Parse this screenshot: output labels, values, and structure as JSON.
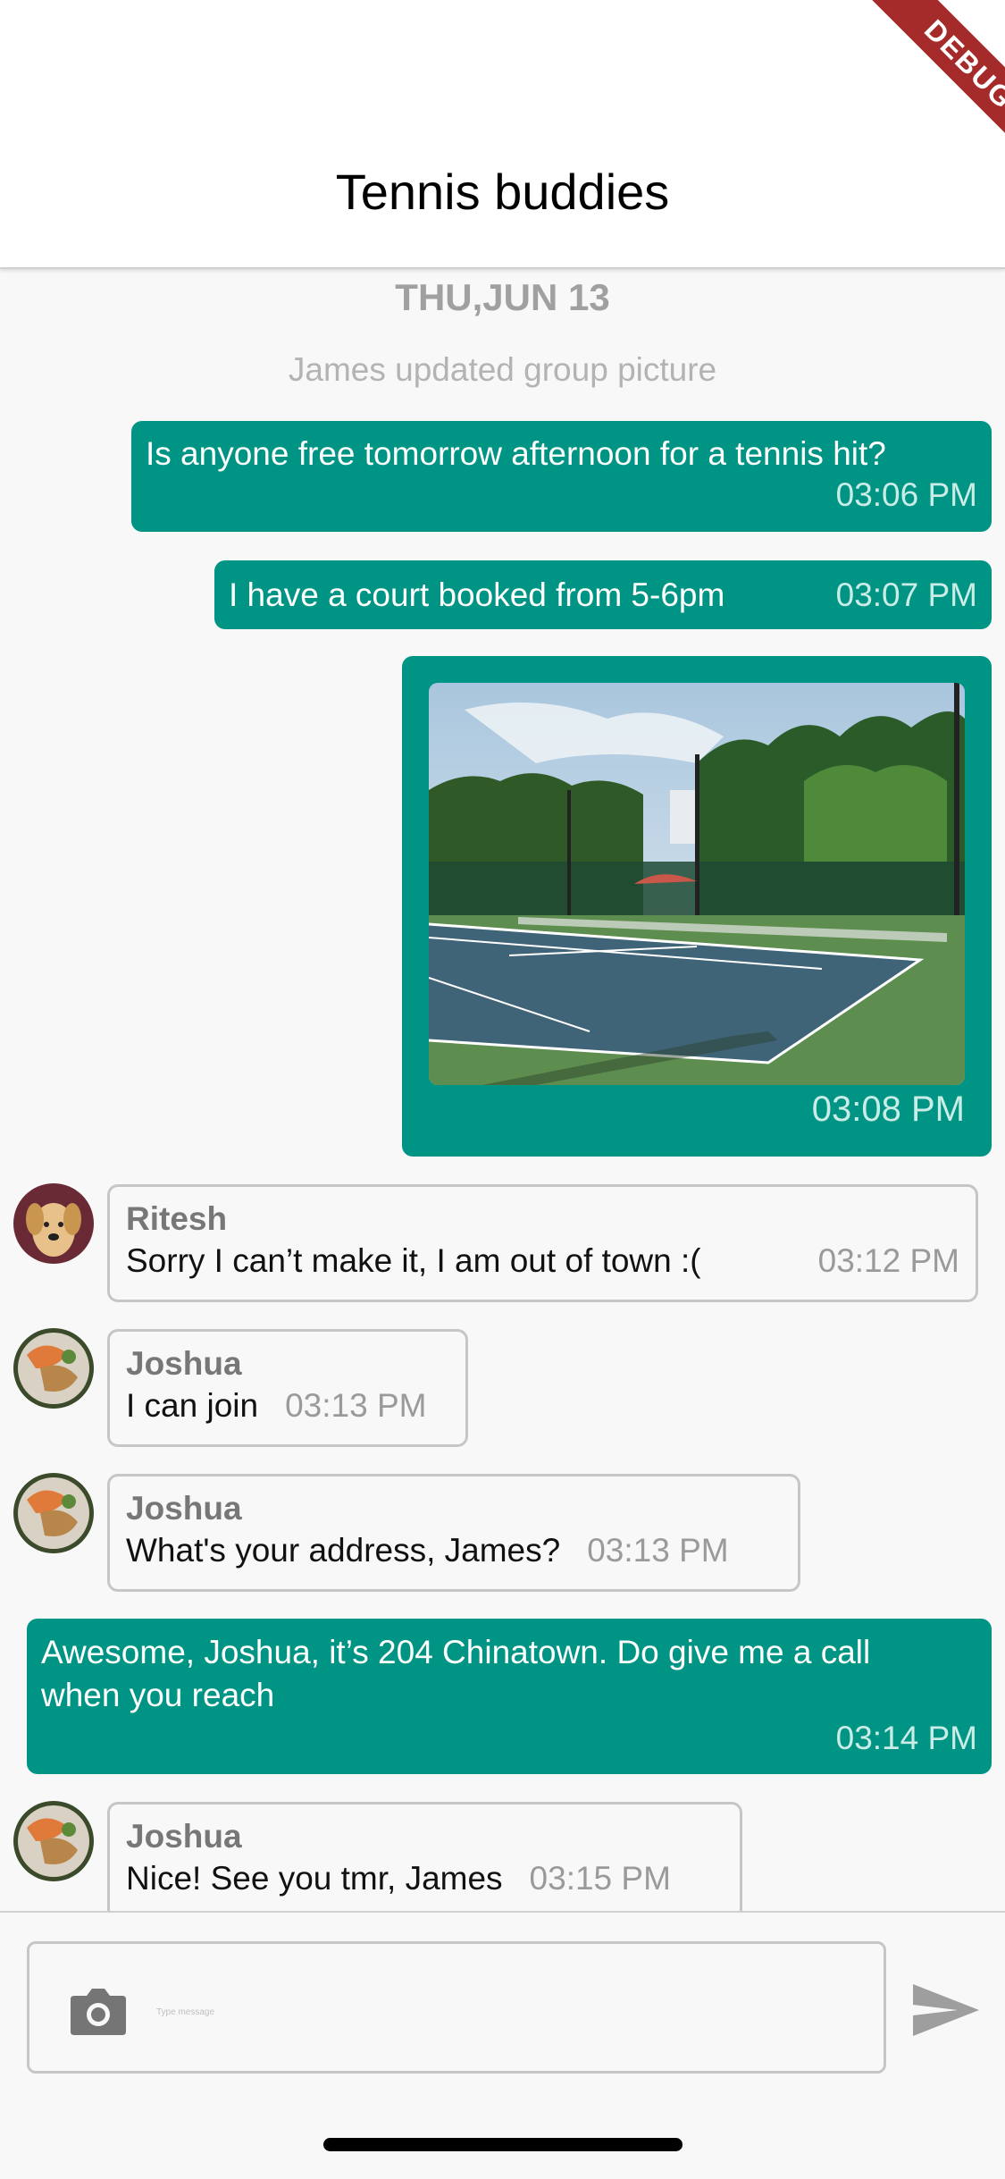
{
  "header": {
    "title": "Tennis buddies",
    "debug_label": "DEBUG"
  },
  "chat": {
    "date_label": "THU,JUN 13",
    "system_note": "James updated group picture",
    "messages": [
      {
        "direction": "out",
        "text": "Is anyone free tomorrow afternoon for a tennis hit?",
        "time": "03:06 PM"
      },
      {
        "direction": "out",
        "text": "I have a court booked from 5-6pm",
        "time": "03:07 PM"
      },
      {
        "direction": "out",
        "type": "image",
        "image": "tennis-court-photo",
        "time": "03:08 PM"
      },
      {
        "direction": "in",
        "sender": "Ritesh",
        "avatar": "dog-avatar",
        "text": "Sorry I can’t make it, I am out of town :(",
        "time": "03:12 PM"
      },
      {
        "direction": "in",
        "sender": "Joshua",
        "avatar": "food-avatar",
        "text": "I can join",
        "time": "03:13 PM"
      },
      {
        "direction": "in",
        "sender": "Joshua",
        "avatar": "food-avatar",
        "text": "What's your address, James?",
        "time": "03:13 PM"
      },
      {
        "direction": "out",
        "text": "Awesome, Joshua, it’s 204 Chinatown. Do give me a call when you reach",
        "time": "03:14 PM"
      },
      {
        "direction": "in",
        "sender": "Joshua",
        "avatar": "food-avatar",
        "text": "Nice! See you tmr, James",
        "time": "03:15 PM"
      }
    ]
  },
  "composer": {
    "placeholder": "Type message",
    "camera_icon": "camera-icon",
    "send_icon": "send-icon"
  },
  "colors": {
    "outgoing_bubble": "#009485",
    "incoming_border": "#c6c6c6",
    "background": "#f8f8f8",
    "debug_ribbon": "#a52a2a"
  }
}
